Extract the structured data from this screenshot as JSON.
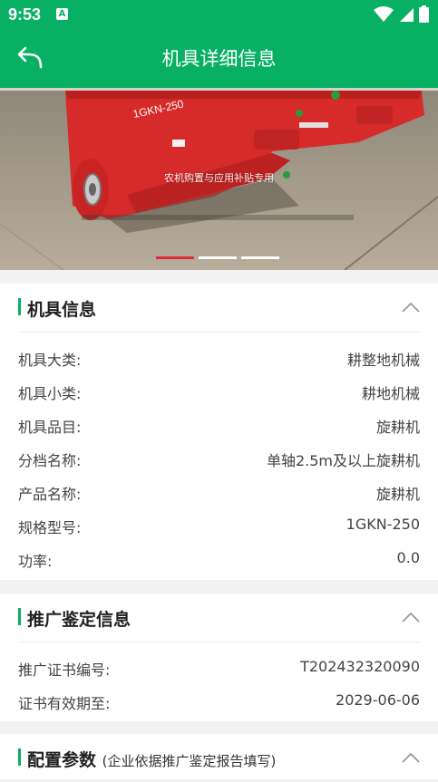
{
  "status": {
    "time": "9:53",
    "notification_letter": "A"
  },
  "appbar": {
    "title": "机具详细信息"
  },
  "banner": {
    "caption": "农机购置与应用补贴专用",
    "machine_label": "1GKN-250",
    "slides": 3,
    "active_slide": 1
  },
  "colors": {
    "primary": "#07b062",
    "indicator_active": "#e32b3a",
    "machine_red": "#d72a2a"
  },
  "sections": [
    {
      "title": "机具信息",
      "rows": [
        {
          "label": "机具大类:",
          "value": "耕整地机械"
        },
        {
          "label": "机具小类:",
          "value": "耕地机械"
        },
        {
          "label": "机具品目:",
          "value": "旋耕机"
        },
        {
          "label": "分档名称:",
          "value": "单轴2.5m及以上旋耕机"
        },
        {
          "label": "产品名称:",
          "value": "旋耕机"
        },
        {
          "label": "规格型号:",
          "value": "1GKN-250"
        },
        {
          "label": "功率:",
          "value": "0.0"
        }
      ]
    },
    {
      "title": "推广鉴定信息",
      "rows": [
        {
          "label": "推广证书编号:",
          "value": "T202432320090"
        },
        {
          "label": "证书有效期至:",
          "value": "2029-06-06"
        }
      ]
    },
    {
      "title": "配置参数",
      "subtitle": "(企业依据推广鉴定报告填写)"
    }
  ],
  "icons": {
    "back": "back-arrow-icon",
    "collapse": "chevron-up-icon",
    "wifi": "wifi-icon",
    "signal": "signal-icon",
    "battery": "battery-icon"
  }
}
